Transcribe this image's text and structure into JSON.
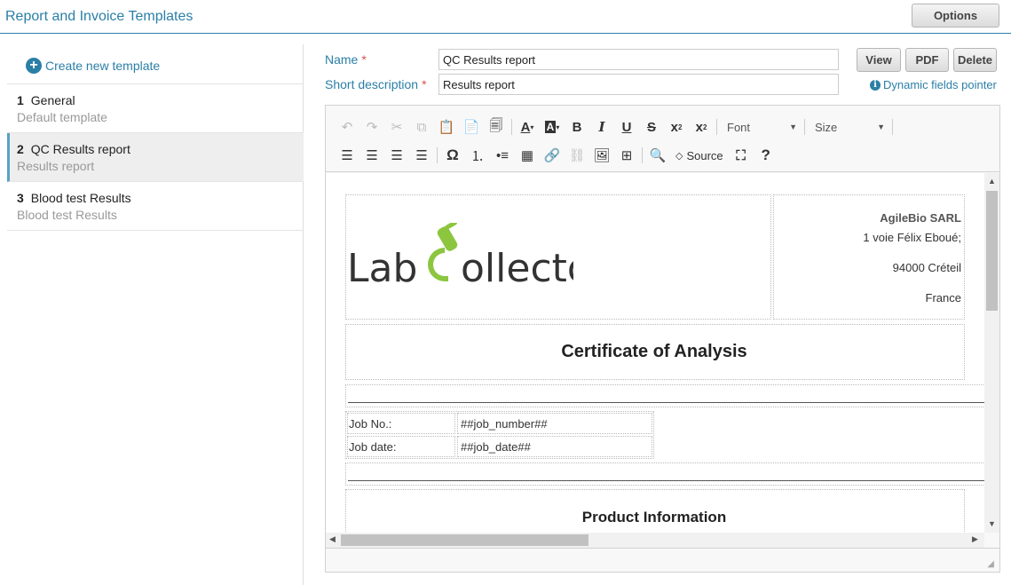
{
  "header": {
    "title": "Report and Invoice Templates",
    "options_label": "Options"
  },
  "sidebar": {
    "create_label": "Create new template",
    "templates": [
      {
        "num": "1",
        "name": "General",
        "desc": "Default template"
      },
      {
        "num": "2",
        "name": "QC Results report",
        "desc": "Results report"
      },
      {
        "num": "3",
        "name": "Blood test Results",
        "desc": "Blood test Results"
      }
    ]
  },
  "form": {
    "name_label": "Name",
    "name_value": "QC Results report",
    "desc_label": "Short description",
    "desc_value": "Results report",
    "required_mark": "*",
    "view_label": "View",
    "pdf_label": "PDF",
    "delete_label": "Delete",
    "dynamic_label": "Dynamic fields pointer"
  },
  "toolbar": {
    "font_label": "Font",
    "size_label": "Size",
    "source_label": "Source",
    "help_label": "?",
    "omega": "Ω"
  },
  "document": {
    "logo_text_a": "Lab",
    "logo_text_b": "ollector",
    "company": "AgileBio SARL",
    "address1": "1 voie Félix Eboué;",
    "address2": "94000 Créteil",
    "country": "France",
    "heading": "Certificate of Analysis",
    "job_no_label": "Job No.:",
    "job_no_value": "##job_number##",
    "job_date_label": "Job date:",
    "job_date_value": "##job_date##",
    "product_heading": "Product Information"
  },
  "colors": {
    "accent": "#2b7fa6",
    "logo_green": "#8cc63f",
    "required": "#d9534f"
  }
}
